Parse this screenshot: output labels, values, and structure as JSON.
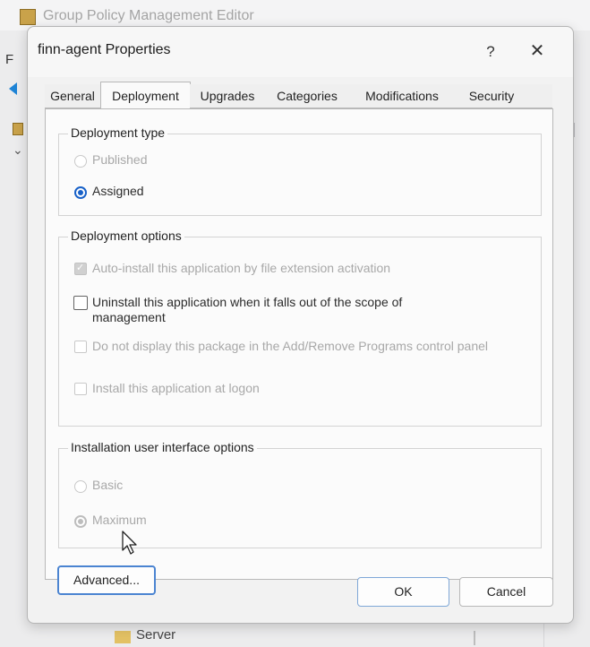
{
  "background": {
    "window_title": "Group Policy Management Editor",
    "menu_letter": "F",
    "tree_item": "Server"
  },
  "dialog": {
    "title": "finn-agent Properties",
    "help_label": "?",
    "close_label": "✕",
    "tabs": [
      {
        "label": "General",
        "active": false
      },
      {
        "label": "Deployment",
        "active": true
      },
      {
        "label": "Upgrades",
        "active": false
      },
      {
        "label": "Categories",
        "active": false
      },
      {
        "label": "Modifications",
        "active": false
      },
      {
        "label": "Security",
        "active": false
      }
    ],
    "deployment_type": {
      "title": "Deployment type",
      "options": [
        {
          "label": "Published",
          "checked": false,
          "enabled": false
        },
        {
          "label": "Assigned",
          "checked": true,
          "enabled": true
        }
      ]
    },
    "deployment_options": {
      "title": "Deployment options",
      "items": [
        {
          "label": "Auto-install this application by file extension activation",
          "checked": true,
          "enabled": false
        },
        {
          "label": "Uninstall this application when it falls out of the scope of management",
          "checked": false,
          "enabled": true
        },
        {
          "label": "Do not display this package in the Add/Remove Programs control panel",
          "checked": false,
          "enabled": false
        },
        {
          "label": "Install this application at logon",
          "checked": false,
          "enabled": false
        }
      ]
    },
    "installation_ui": {
      "title": "Installation user interface options",
      "options": [
        {
          "label": "Basic",
          "checked": false,
          "enabled": false
        },
        {
          "label": "Maximum",
          "checked": true,
          "enabled": false
        }
      ]
    },
    "buttons": {
      "advanced": "Advanced...",
      "ok": "OK",
      "cancel": "Cancel"
    }
  },
  "colors": {
    "accent": "#1861c8",
    "disabled_text": "#a8a8a8",
    "panel": "#fbfbfb"
  }
}
